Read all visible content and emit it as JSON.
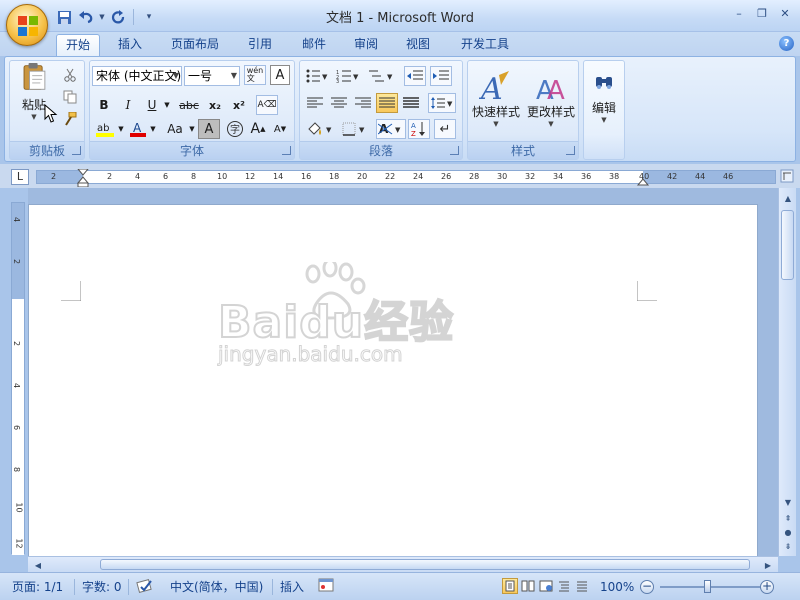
{
  "window": {
    "title": "文档 1 - Microsoft Word",
    "minimize": "–",
    "restore": "❐",
    "close": "✕"
  },
  "quick_access": {
    "items": [
      "save-icon",
      "undo-icon",
      "redo-icon",
      "customize-icon"
    ]
  },
  "tabs": [
    {
      "label": "开始",
      "active": true
    },
    {
      "label": "插入"
    },
    {
      "label": "页面布局"
    },
    {
      "label": "引用"
    },
    {
      "label": "邮件"
    },
    {
      "label": "审阅"
    },
    {
      "label": "视图"
    },
    {
      "label": "开发工具"
    }
  ],
  "help": "?",
  "ribbon": {
    "clipboard": {
      "label": "剪贴板",
      "paste": "粘贴"
    },
    "font": {
      "label": "字体",
      "font_name": "宋体 (中文正文)",
      "font_size": "一号",
      "bold": "B",
      "italic": "I",
      "underline": "U",
      "strike": "abc",
      "subscript": "x₂",
      "superscript": "x²",
      "change_case": "Aa",
      "grow": "A",
      "shrink": "A"
    },
    "paragraph": {
      "label": "段落"
    },
    "styles": {
      "label": "样式",
      "quick_styles": "快速样式",
      "change_styles": "更改样式"
    },
    "editing": {
      "label": "编辑"
    }
  },
  "ruler": {
    "corner": "L",
    "h_numbers": [
      "2",
      "2",
      "4",
      "6",
      "8",
      "10",
      "12",
      "14",
      "16",
      "18",
      "20",
      "22",
      "24",
      "26",
      "28",
      "30",
      "32",
      "34",
      "36",
      "38",
      "40",
      "42",
      "44",
      "46"
    ],
    "v_numbers": [
      "4",
      "2",
      "2",
      "4",
      "6",
      "8",
      "10",
      "12"
    ]
  },
  "watermark": {
    "brand": "Baidu经验",
    "url": "jingyan.baidu.com"
  },
  "statusbar": {
    "page": "页面: 1/1",
    "words": "字数: 0",
    "language": "中文(简体，中国)",
    "mode": "插入",
    "zoom": "100%"
  },
  "colors": {
    "accent": "#15428b",
    "ribbon_bg": "#d7e6f9",
    "highlight": "#f9c85b",
    "font_color": "#e00000"
  }
}
